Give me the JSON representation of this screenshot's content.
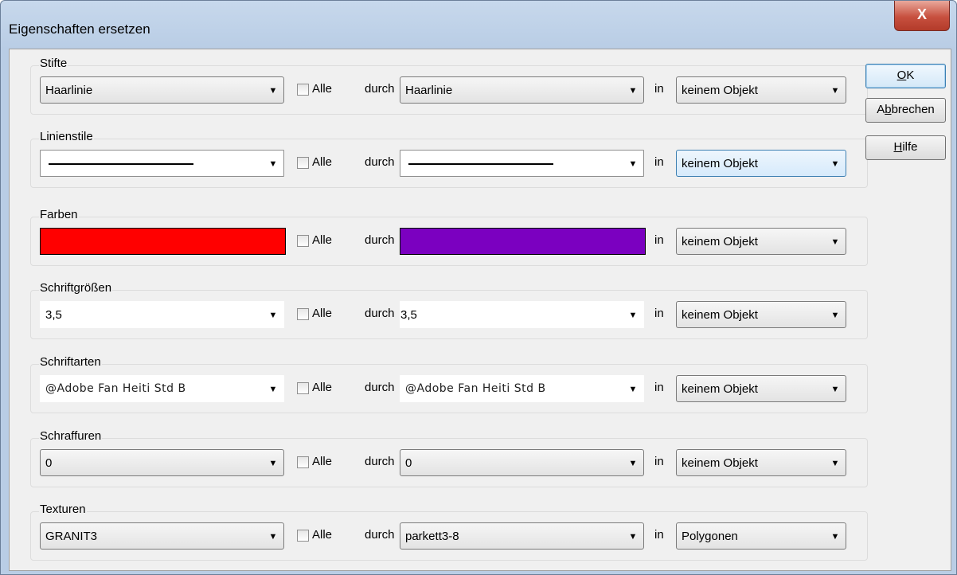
{
  "window": {
    "title": "Eigenschaften ersetzen",
    "close_label": "X"
  },
  "common": {
    "alle_label": "Alle",
    "durch_label": "durch",
    "in_label": "in"
  },
  "buttons": {
    "ok": {
      "pre": "",
      "accel": "O",
      "post": "K"
    },
    "cancel": {
      "pre": "A",
      "accel": "b",
      "post": "brechen"
    },
    "help": {
      "pre": "",
      "accel": "H",
      "post": "ilfe"
    }
  },
  "groups": {
    "stifte": {
      "label": "Stifte",
      "source": "Haarlinie",
      "target": "Haarlinie",
      "scope": "keinem Objekt"
    },
    "linienstile": {
      "label": "Linienstile",
      "source": "solid-line",
      "target": "solid-line",
      "scope": "keinem Objekt"
    },
    "farben": {
      "label": "Farben",
      "source_color": "#ff0000",
      "target_color": "#7b00c0",
      "scope": "keinem Objekt"
    },
    "schriftgroessen": {
      "label": "Schriftgrößen",
      "source": "3,5",
      "target": "3,5",
      "scope": "keinem Objekt"
    },
    "schriftarten": {
      "label": "Schriftarten",
      "source": "@Adobe Fan Heiti Std B",
      "target": "@Adobe Fan Heiti Std B",
      "scope": "keinem Objekt"
    },
    "schraffuren": {
      "label": "Schraffuren",
      "source": "0",
      "target": "0",
      "scope": "keinem Objekt"
    },
    "texturen": {
      "label": "Texturen",
      "source": "GRANIT3",
      "target": "parkett3-8",
      "scope": "Polygonen"
    }
  }
}
